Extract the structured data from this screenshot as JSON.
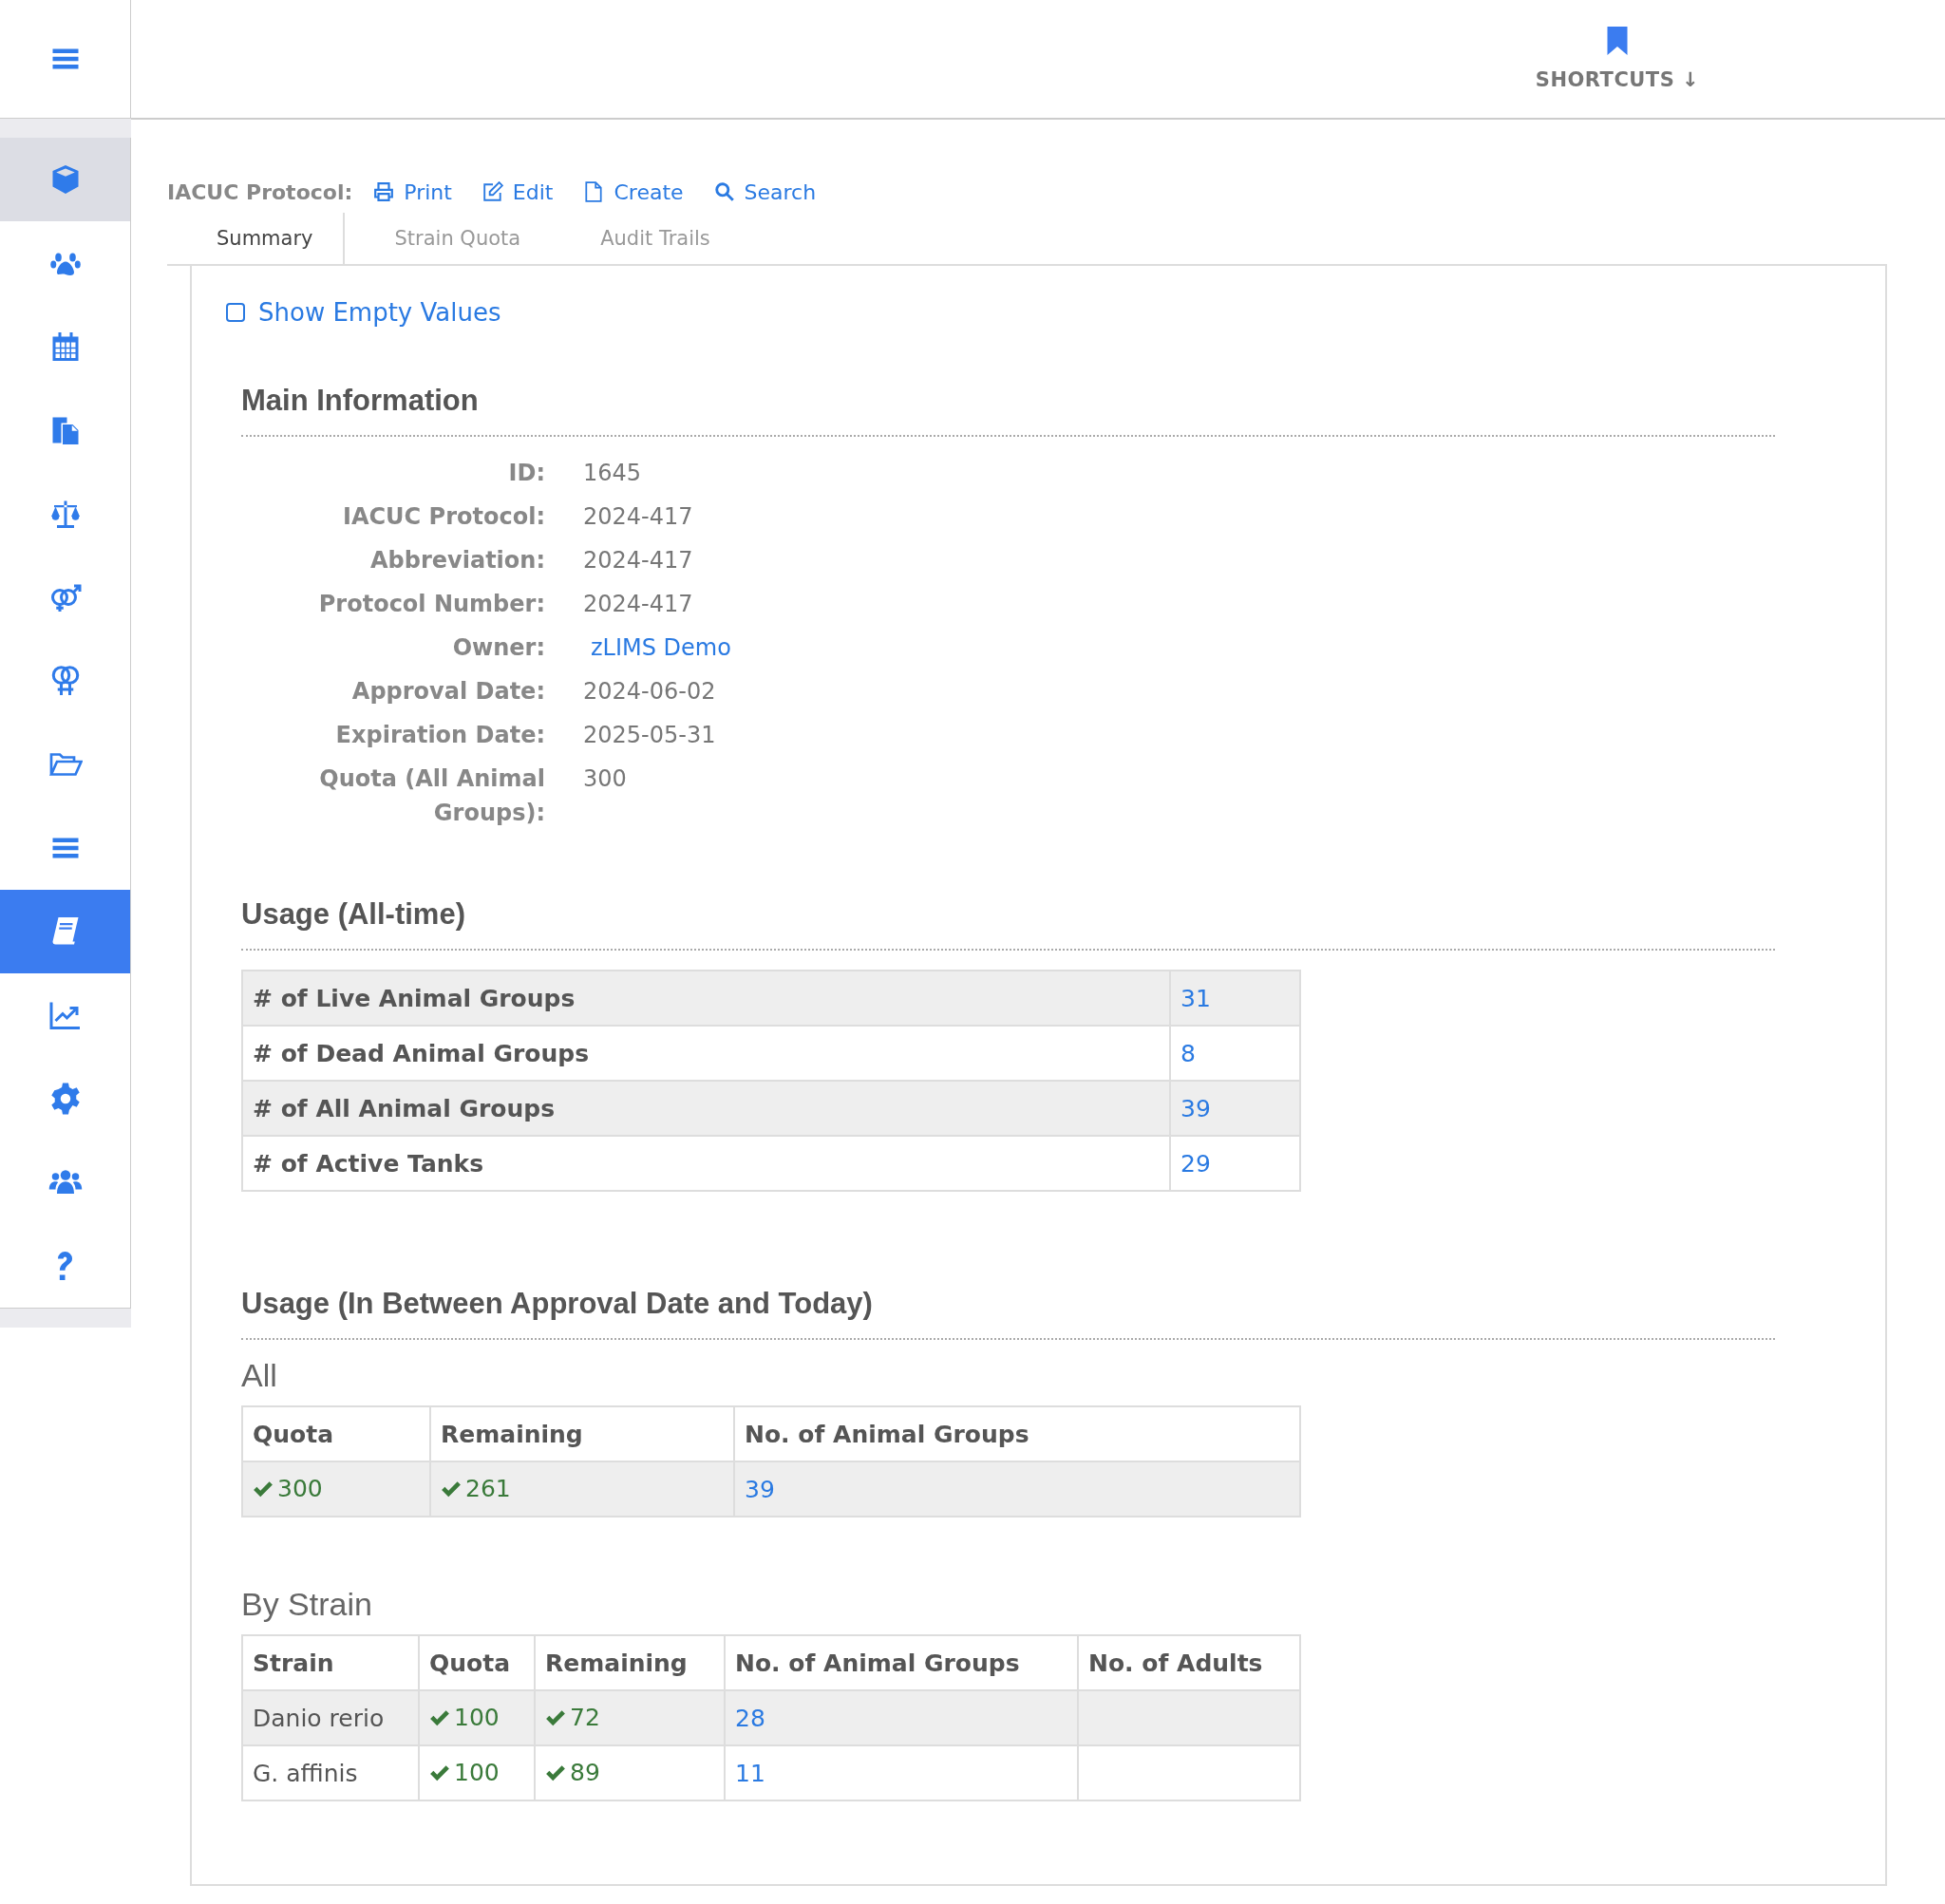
{
  "header": {
    "shortcuts_label": "SHORTCUTS ↓"
  },
  "sidebar": {
    "items": [
      {
        "selected": false,
        "highlighted": true
      },
      {
        "selected": false,
        "highlighted": false
      },
      {
        "selected": false,
        "highlighted": false
      },
      {
        "selected": false,
        "highlighted": false
      },
      {
        "selected": false,
        "highlighted": false
      },
      {
        "selected": false,
        "highlighted": false
      },
      {
        "selected": false,
        "highlighted": false
      },
      {
        "selected": false,
        "highlighted": false
      },
      {
        "selected": false,
        "highlighted": false
      },
      {
        "selected": true,
        "highlighted": false
      },
      {
        "selected": false,
        "highlighted": false
      },
      {
        "selected": false,
        "highlighted": false
      },
      {
        "selected": false,
        "highlighted": false
      },
      {
        "selected": false,
        "highlighted": false
      }
    ]
  },
  "toolbar": {
    "label": "IACUC Protocol:",
    "actions": [
      {
        "label": "Print",
        "kind": "print"
      },
      {
        "label": "Edit",
        "kind": "edit"
      },
      {
        "label": "Create",
        "kind": "create"
      },
      {
        "label": "Search",
        "kind": "search"
      }
    ]
  },
  "tabs": [
    {
      "label": "Summary",
      "selected": true
    },
    {
      "label": "Strain Quota",
      "selected": false
    },
    {
      "label": "Audit Trails",
      "selected": false
    }
  ],
  "show_empty": {
    "label": "Show Empty Values",
    "checked": false
  },
  "main_info": {
    "title": "Main Information",
    "fields": [
      {
        "label": "ID:",
        "value": "1645",
        "kind": "text"
      },
      {
        "label": "IACUC Protocol:",
        "value": "2024-417",
        "kind": "text"
      },
      {
        "label": "Abbreviation:",
        "value": "2024-417",
        "kind": "text"
      },
      {
        "label": "Protocol Number:",
        "value": "2024-417",
        "kind": "text"
      },
      {
        "label": "Owner:",
        "value": "zLIMS Demo",
        "kind": "link"
      },
      {
        "label": "Approval Date:",
        "value": "2024-06-02",
        "kind": "text"
      },
      {
        "label": "Expiration Date:",
        "value": "2025-05-31",
        "kind": "text"
      },
      {
        "label": "Quota (All Animal Groups):",
        "value": "300",
        "kind": "text"
      }
    ]
  },
  "usage_all": {
    "title": "Usage (All-time)",
    "rows": [
      {
        "label": "# of Live Animal Groups",
        "value": "31"
      },
      {
        "label": "# of Dead Animal Groups",
        "value": "8"
      },
      {
        "label": "# of All Animal Groups",
        "value": "39"
      },
      {
        "label": "# of Active Tanks",
        "value": "29"
      }
    ]
  },
  "usage_between": {
    "title": "Usage (In Between Approval Date and Today)",
    "all": {
      "subtitle": "All",
      "columns": [
        "Quota",
        "Remaining",
        "No. of Animal Groups"
      ],
      "rows": [
        [
          {
            "text": "300",
            "kind": "check"
          },
          {
            "text": "261",
            "kind": "check"
          },
          {
            "text": "39",
            "kind": "link"
          }
        ]
      ]
    },
    "by_strain": {
      "subtitle": "By Strain",
      "columns": [
        "Strain",
        "Quota",
        "Remaining",
        "No. of Animal Groups",
        "No. of Adults"
      ],
      "rows": [
        [
          {
            "text": "Danio rerio",
            "kind": "text"
          },
          {
            "text": "100",
            "kind": "check"
          },
          {
            "text": "72",
            "kind": "check"
          },
          {
            "text": "28",
            "kind": "link"
          },
          {
            "text": "",
            "kind": "text"
          }
        ],
        [
          {
            "text": "G. affinis",
            "kind": "text"
          },
          {
            "text": "100",
            "kind": "check"
          },
          {
            "text": "89",
            "kind": "check"
          },
          {
            "text": "11",
            "kind": "link"
          },
          {
            "text": "",
            "kind": "text"
          }
        ]
      ]
    }
  }
}
